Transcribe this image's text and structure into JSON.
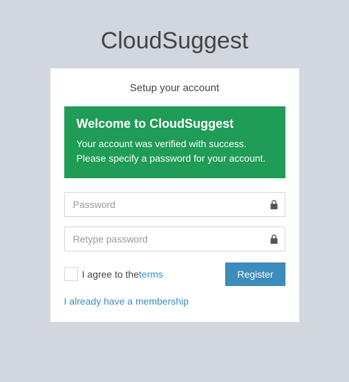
{
  "brand": "CloudSuggest",
  "subtitle": "Setup your account",
  "alert": {
    "title": "Welcome to CloudSuggest",
    "line1": "Your account was verified with success.",
    "line2": "Please specify a password for your account."
  },
  "form": {
    "password_placeholder": "Password",
    "retype_placeholder": "Retype password",
    "agree_prefix": "I agree to the ",
    "terms_label": "terms",
    "register_label": "Register"
  },
  "membership_link": "I already have a membership",
  "colors": {
    "page_bg": "#d2d6de",
    "card_bg": "#ffffff",
    "alert_bg": "#1f9c56",
    "primary": "#3c8dbc"
  }
}
